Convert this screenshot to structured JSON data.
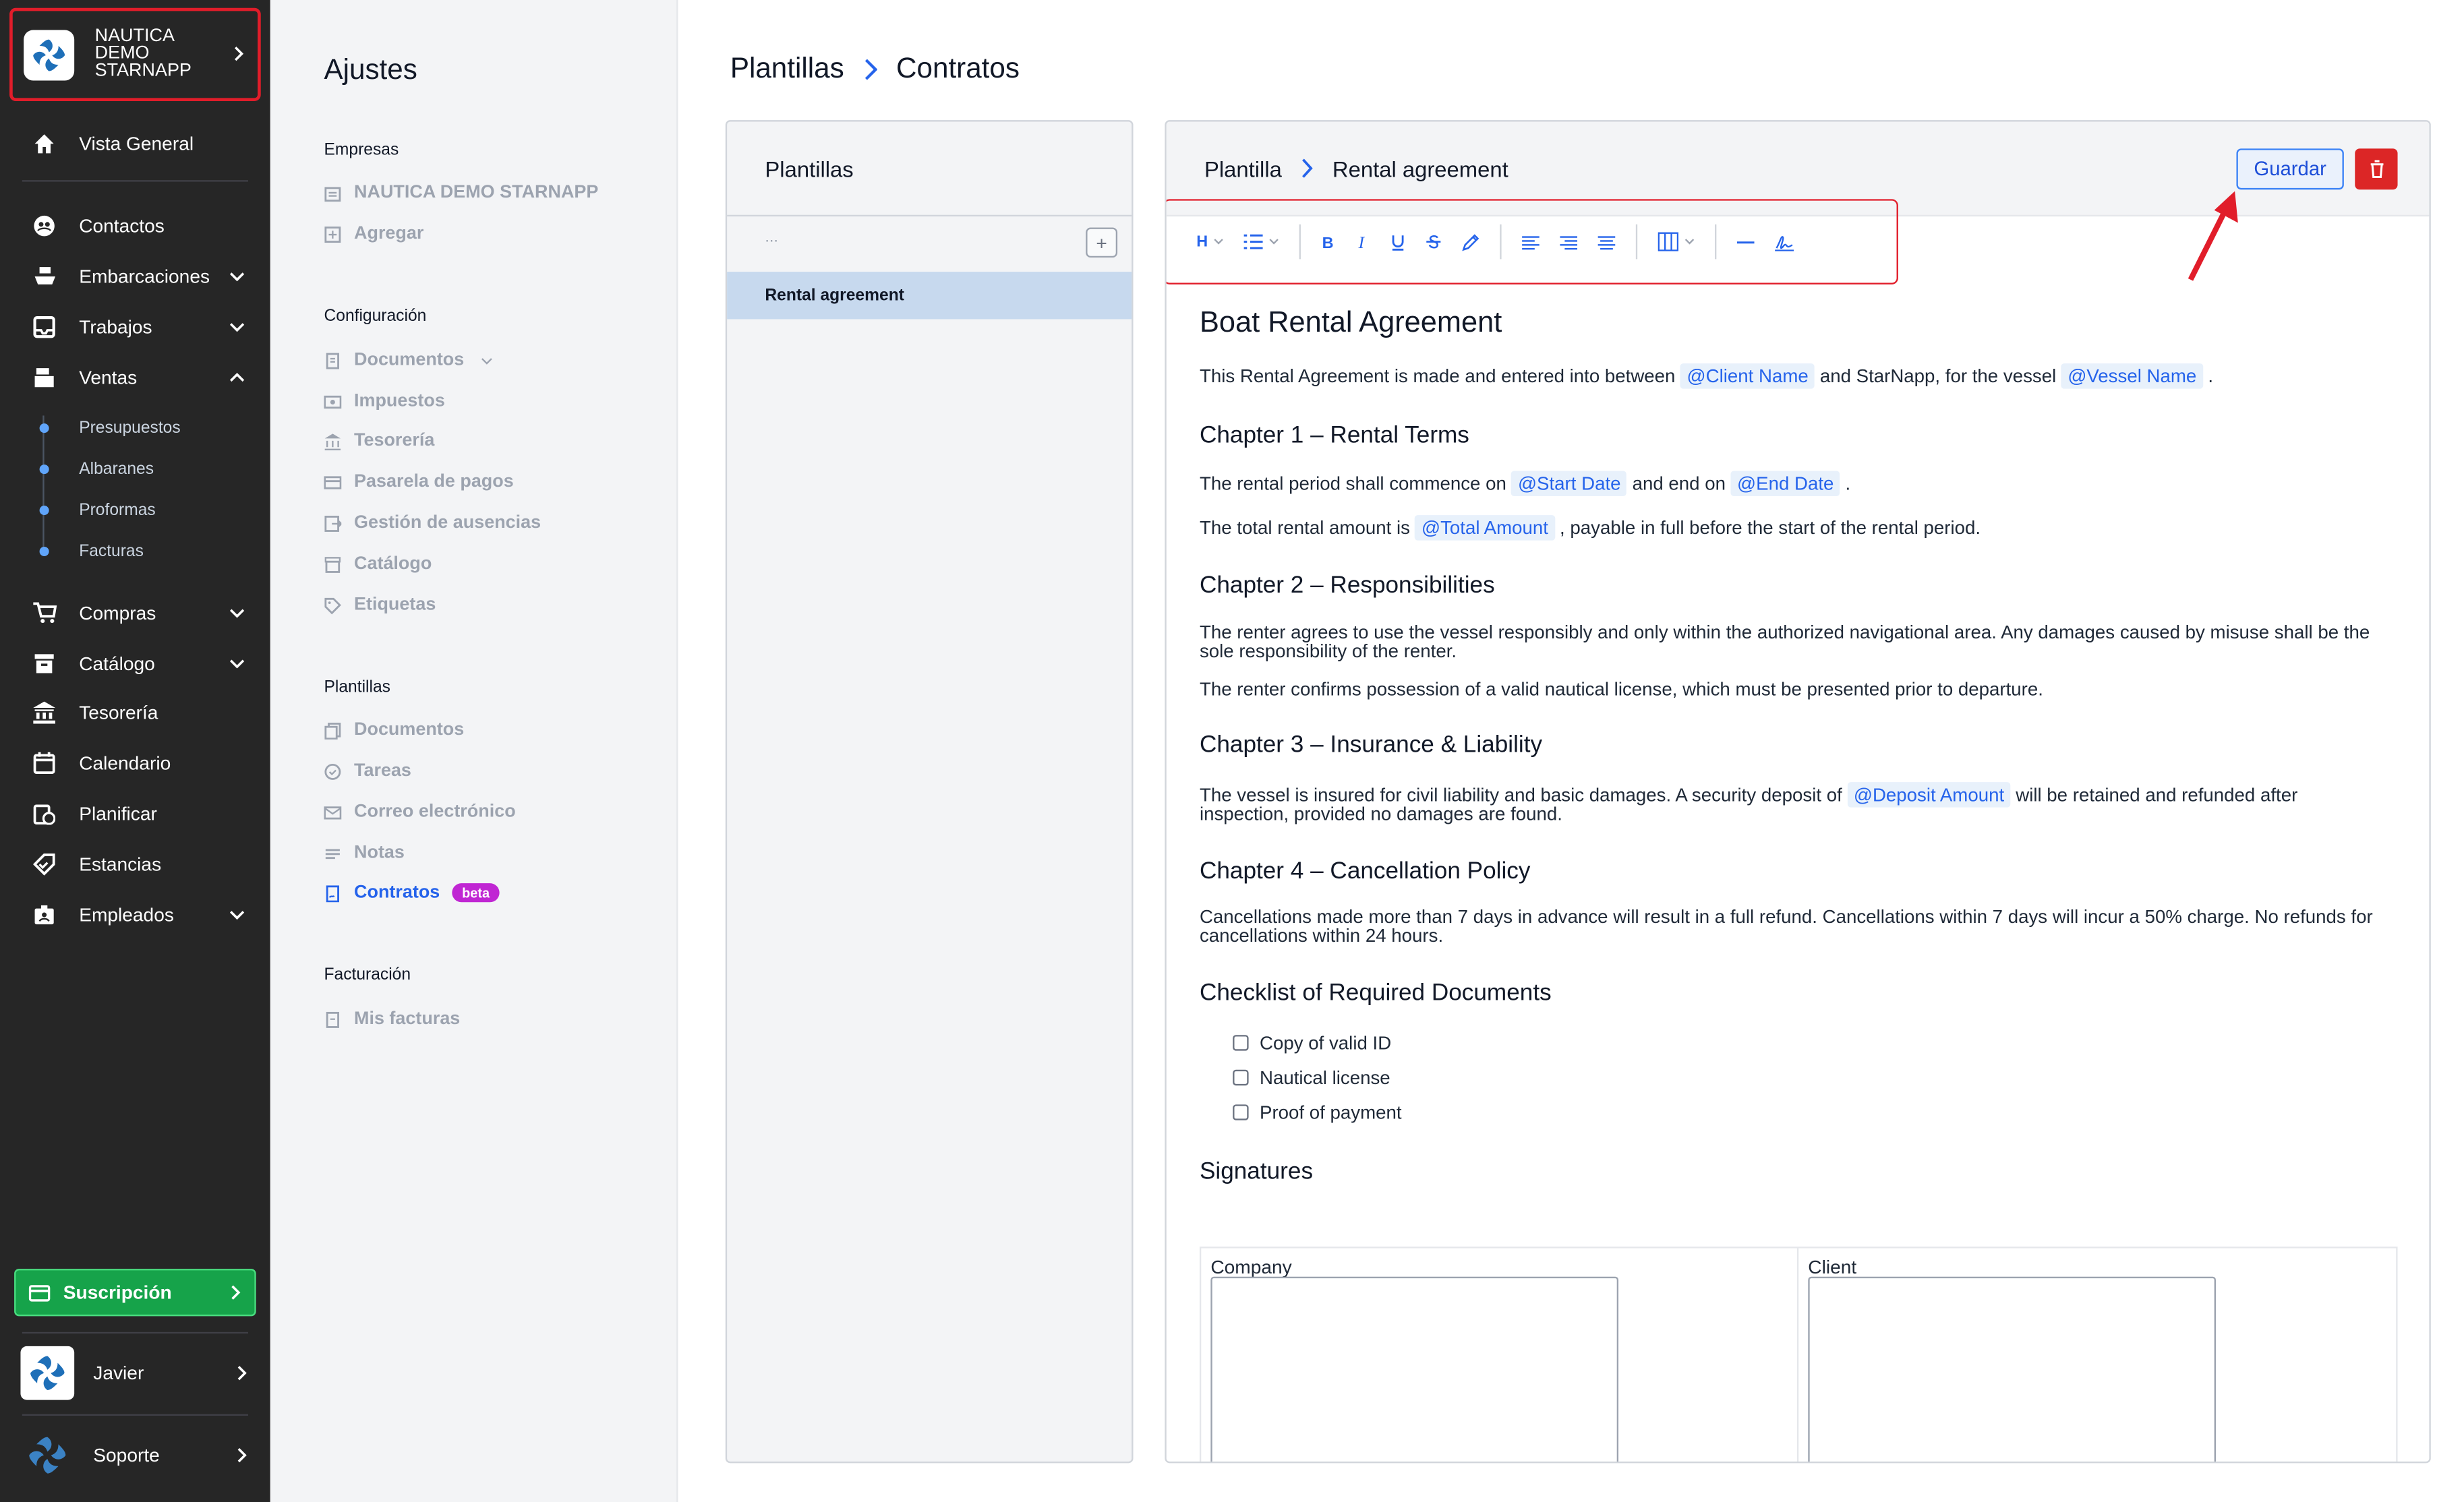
{
  "sidebar": {
    "company": "NAUTICA DEMO STARNAPP",
    "nav": [
      "Vista General",
      "Contactos",
      "Embarcaciones",
      "Trabajos",
      "Ventas",
      "Compras",
      "Catálogo",
      "Tesorería",
      "Calendario",
      "Planificar",
      "Estancias",
      "Empleados"
    ],
    "ventas_sub": [
      "Presupuestos",
      "Albaranes",
      "Proformas",
      "Facturas"
    ],
    "subscription": "Suscripción",
    "user": "Javier",
    "support": "Soporte"
  },
  "settings": {
    "title": "Ajustes",
    "groups": {
      "empresas": "Empresas",
      "configuracion": "Configuración",
      "plantillas": "Plantillas",
      "facturacion": "Facturación"
    },
    "empresas_items": [
      "NAUTICA DEMO STARNAPP",
      "Agregar"
    ],
    "config_items": [
      "Documentos",
      "Impuestos",
      "Tesorería",
      "Pasarela de pagos",
      "Gestión de ausencias",
      "Catálogo",
      "Etiquetas"
    ],
    "plantillas_items": [
      "Documentos",
      "Tareas",
      "Correo electrónico",
      "Notas",
      "Contratos"
    ],
    "beta": "beta",
    "facturacion_items": [
      "Mis facturas"
    ]
  },
  "main": {
    "breadcrumb": [
      "Plantillas",
      "Contratos"
    ],
    "list": {
      "title": "Plantillas",
      "search_placeholder": "...",
      "add": "+",
      "items": [
        "Rental agreement"
      ]
    },
    "editor": {
      "breadcrumb": [
        "Plantilla",
        "Rental agreement"
      ],
      "save": "Guardar",
      "toolbar_heading": "H"
    }
  },
  "document": {
    "title": "Boat Rental Agreement",
    "intro": {
      "t1": "This Rental Agreement is made and entered into between",
      "tag1": "@Client Name",
      "t2": "and StarNapp, for the vessel",
      "tag2": "@Vessel Name",
      "t3": "."
    },
    "ch1": "Chapter 1 – Rental Terms",
    "ch1_p1": {
      "t1": "The rental period shall commence on",
      "tag1": "@Start Date",
      "t2": "and end on",
      "tag2": "@End Date",
      "t3": "."
    },
    "ch1_p2": {
      "t1": "The total rental amount is",
      "tag1": "@Total Amount",
      "t2": ", payable in full before the start of the rental period."
    },
    "ch2": "Chapter 2 – Responsibilities",
    "ch2_p1": "The renter agrees to use the vessel responsibly and only within the authorized navigational area. Any damages caused by misuse shall be the sole responsibility of the renter.",
    "ch2_p2": "The renter confirms possession of a valid nautical license, which must be presented prior to departure.",
    "ch3": "Chapter 3 – Insurance & Liability",
    "ch3_p1": {
      "t1": "The vessel is insured for civil liability and basic damages. A security deposit of",
      "tag1": "@Deposit Amount",
      "t2": "will be retained and refunded after inspection, provided no damages are found."
    },
    "ch4": "Chapter 4 – Cancellation Policy",
    "ch4_p1": "Cancellations made more than 7 days in advance will result in a full refund. Cancellations within 7 days will incur a 50% charge. No refunds for cancellations within 24 hours.",
    "checklist_title": "Checklist of Required Documents",
    "checklist": [
      "Copy of valid ID",
      "Nautical license",
      "Proof of payment"
    ],
    "signatures_title": "Signatures",
    "sig_company": "Company",
    "sig_client": "Client"
  },
  "colors": {
    "accent": "#2563eb",
    "sidebar": "#262626",
    "annotation": "#e11d2a",
    "success": "#16a34a",
    "beta": "#c026d3"
  }
}
